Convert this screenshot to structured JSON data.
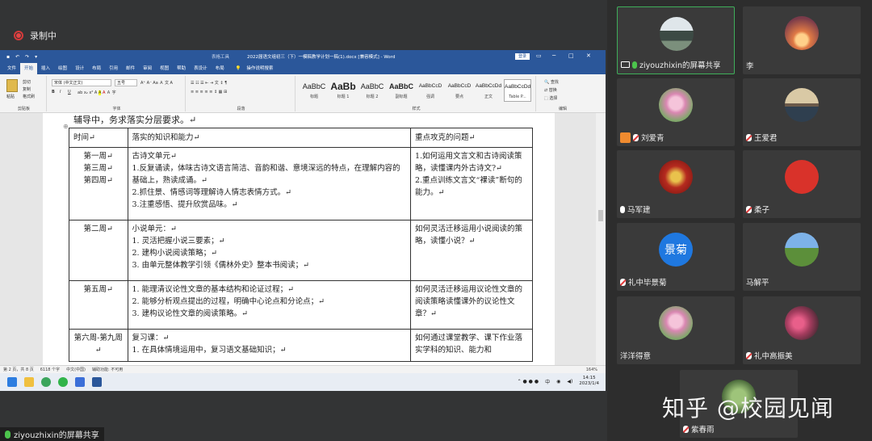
{
  "recording": {
    "label": "录制中"
  },
  "word": {
    "title": "2022届语文组初三（下）一模稿教学计划一稿(1).docx [兼容模式] - Word",
    "context_tools": "表格工具",
    "login": "登录",
    "quick_access": [
      "保存",
      "撤销",
      "重做",
      "自定义"
    ],
    "menu": [
      "文件",
      "开始",
      "插入",
      "绘图",
      "设计",
      "布局",
      "引用",
      "邮件",
      "审阅",
      "视图",
      "帮助",
      "表设计",
      "布局"
    ],
    "active_menu_index": 1,
    "tell_me": "操作说明搜索",
    "ribbon": {
      "clipboard_label": "剪贴板",
      "paste": "粘贴",
      "cut": "剪切",
      "copy": "复制",
      "format_painter": "格式刷",
      "font_label": "字体",
      "font_name": "宋体 (中文正文)",
      "font_size": "五号",
      "paragraph_label": "段落",
      "styles_label": "样式",
      "editing_label": "编辑",
      "find": "查找",
      "replace": "替换",
      "select": "选择",
      "styles": [
        {
          "sample": "AaBbC",
          "name": "标题"
        },
        {
          "sample": "AaBb",
          "name": "标题 1"
        },
        {
          "sample": "AaBbC",
          "name": "标题 2"
        },
        {
          "sample": "AaBbC",
          "name": "副标题"
        },
        {
          "sample": "AaBbCcD",
          "name": "强调"
        },
        {
          "sample": "AaBbCcD",
          "name": "要点"
        },
        {
          "sample": "AaBbCcDd",
          "name": "正文"
        },
        {
          "sample": "AaBbCcDd",
          "name": "Table P..."
        }
      ]
    },
    "doc": {
      "pre_text": "辅导中，务求落实分层要求。↵",
      "table": {
        "headers": [
          "时间↵",
          "落实的知识和能力↵",
          "重点攻克的问题↵"
        ],
        "rows": [
          {
            "time": [
              "第一周↵",
              "第三周↵",
              "第四周↵"
            ],
            "knowledge": [
              "古诗文单元↵",
              "1.反复诵读，体味古诗文语言简洁、音韵和谐、意境深远的特点，在理解内容的基础上，熟读成诵。↵",
              "2.抓住景、情感词等理解诗人情志表情方式。↵",
              "3.注重感悟、提升欣赏品味。↵"
            ],
            "problems": [
              "1.如何运用文言文和古诗阅读策略，读懂课内外古诗文?↵",
              "2.重点训练文言文“裸读”断句的能力。↵"
            ]
          },
          {
            "time": [
              "第二周↵"
            ],
            "knowledge": [
              "小说单元：↵",
              "1. 灵活把握小说三要素；↵",
              "2. 建构小说阅读策略；↵",
              "3. 由单元整体教学引领《儒林外史》整本书阅读；↵"
            ],
            "problems": [
              "如何灵活迁移运用小说阅读的策略，读懂小说？↵"
            ]
          },
          {
            "time": [
              "第五周↵"
            ],
            "knowledge": [
              "1. 能理清议论性文章的基本结构和论证过程；↵",
              "2. 能够分析观点提出的过程，明确中心论点和分论点；↵",
              "3. 建构议论性文章的阅读策略。↵"
            ],
            "problems": [
              "如何灵活迁移运用议论性文章的阅读策略读懂课外的议论性文章？↵"
            ]
          },
          {
            "time": [
              "第六周-第九周↵"
            ],
            "knowledge": [
              "复习课：↵",
              "1.  在具体情境运用中，复习语文基础知识；↵"
            ],
            "problems": [
              "如何通过课堂教学、课下作业落实学科的知识、能力和"
            ]
          }
        ]
      }
    },
    "status": {
      "page": "第 2 页，共 8 页",
      "words": "6118 个字",
      "language": "中文(中国)",
      "accessibility": "辅助功能: 不可用",
      "zoom": "164%"
    }
  },
  "taskbar": {
    "clock_time": "14:15",
    "clock_date": "2023/1/4",
    "ime": "中"
  },
  "share_label": "ziyouzhixin的屏幕共享",
  "participants": [
    {
      "name": "ziyouzhixin的屏幕共享",
      "avatar": "building",
      "icon": "screen-mic",
      "active": true
    },
    {
      "name": "李",
      "avatar": "sunset",
      "icon": "none",
      "active": false
    },
    {
      "name": "刘爱青",
      "avatar": "flower",
      "icon": "user-mic-off",
      "active": false
    },
    {
      "name": "王爱君",
      "avatar": "bridge",
      "icon": "mic-off",
      "active": false
    },
    {
      "name": "马军建",
      "avatar": "poster",
      "icon": "mic",
      "active": false
    },
    {
      "name": "柔子",
      "avatar": "seal",
      "icon": "mic-off",
      "active": false
    },
    {
      "name": "礼中毕景菊",
      "avatar": "text-景菊",
      "icon": "mic-off",
      "active": false
    },
    {
      "name": "马解平",
      "avatar": "landscape",
      "icon": "none",
      "active": false
    },
    {
      "name": "洋洋得意",
      "avatar": "flower",
      "icon": "none",
      "active": false
    },
    {
      "name": "礼中高振美",
      "avatar": "people",
      "icon": "mic-off",
      "active": false
    },
    {
      "name": "紫春雨",
      "avatar": "flowerpot",
      "icon": "mic-off",
      "active": false
    }
  ],
  "watermark": "知乎 @校园见闻",
  "colors": {
    "word_blue": "#2b579a",
    "active_tile_border": "#3fae5a",
    "record_red": "#e34444"
  }
}
